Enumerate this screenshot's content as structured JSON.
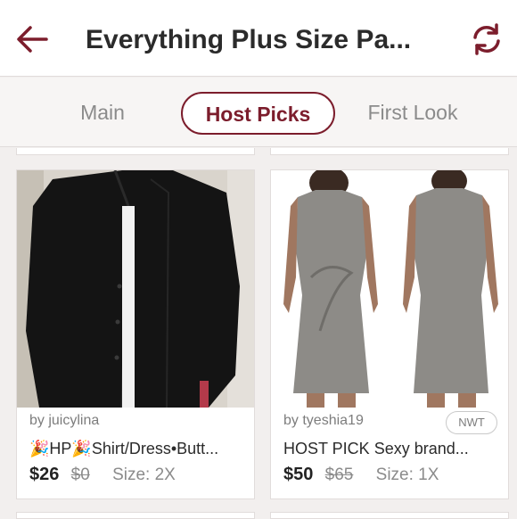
{
  "header": {
    "title": "Everything Plus Size Pa..."
  },
  "tabs": [
    {
      "label": "Main",
      "active": false
    },
    {
      "label": "Host Picks",
      "active": true
    },
    {
      "label": "First Look",
      "active": false
    }
  ],
  "listings": [
    {
      "seller": "by juicylina",
      "title": "🎉HP🎉Shirt/Dress•Butt...",
      "price": "$26",
      "original_price": "$0",
      "size": "Size: 2X",
      "badge": ""
    },
    {
      "seller": "by tyeshia19",
      "title": "HOST PICK Sexy brand...",
      "price": "$50",
      "original_price": "$65",
      "size": "Size: 1X",
      "badge": "NWT"
    }
  ],
  "colors": {
    "accent": "#7c1d2c",
    "background": "#f2efee"
  },
  "icons": {
    "back": "arrow-left-icon",
    "refresh": "refresh-icon"
  }
}
